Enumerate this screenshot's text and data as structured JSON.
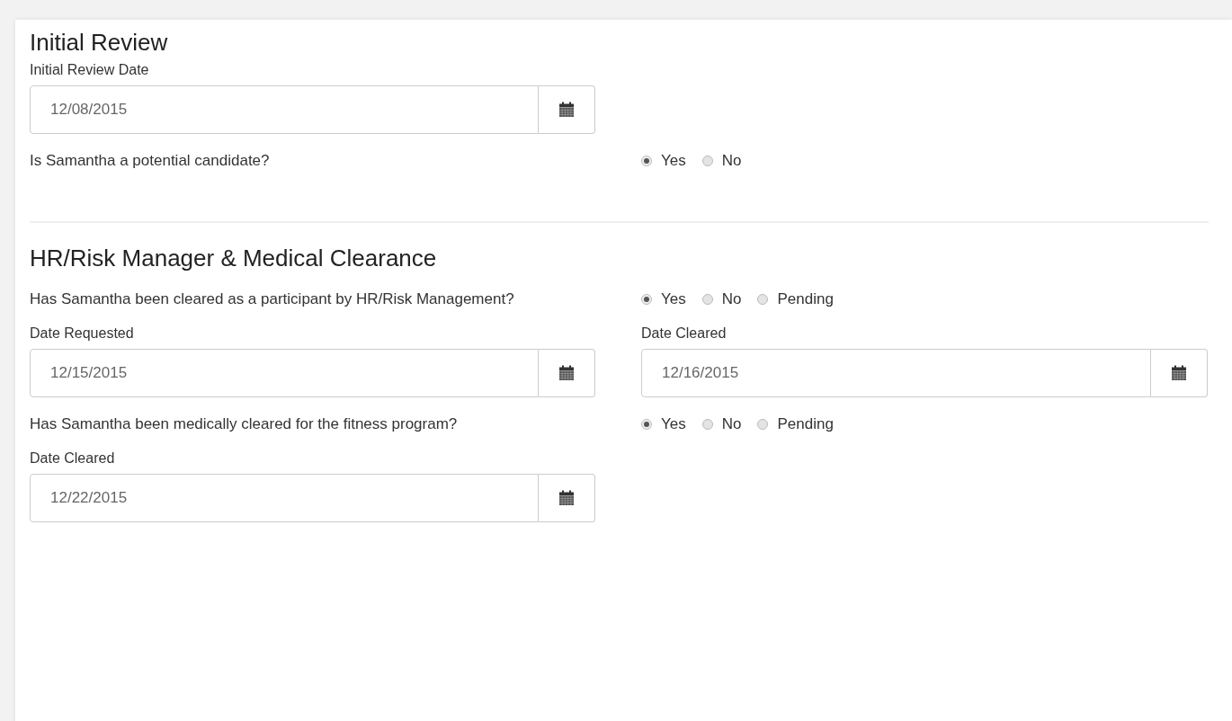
{
  "sections": [
    {
      "title": "Initial Review",
      "rows": [
        {
          "kind": "date",
          "fields": [
            {
              "label": "Initial Review Date",
              "value": "12/08/2015"
            }
          ]
        },
        {
          "kind": "question",
          "text": "Is Samantha a potential candidate?",
          "options": [
            {
              "label": "Yes",
              "selected": true
            },
            {
              "label": "No",
              "selected": false
            }
          ]
        }
      ]
    },
    {
      "title": "HR/Risk Manager & Medical Clearance",
      "rows": [
        {
          "kind": "question",
          "text": "Has Samantha been cleared as a participant by HR/Risk Management?",
          "options": [
            {
              "label": "Yes",
              "selected": true
            },
            {
              "label": "No",
              "selected": false
            },
            {
              "label": "Pending",
              "selected": false
            }
          ]
        },
        {
          "kind": "date",
          "fields": [
            {
              "label": "Date Requested",
              "value": "12/15/2015"
            },
            {
              "label": "Date Cleared",
              "value": "12/16/2015"
            }
          ]
        },
        {
          "kind": "question",
          "text": "Has Samantha been medically cleared for the fitness program?",
          "options": [
            {
              "label": "Yes",
              "selected": true
            },
            {
              "label": "No",
              "selected": false
            },
            {
              "label": "Pending",
              "selected": false
            }
          ]
        },
        {
          "kind": "date",
          "fields": [
            {
              "label": "Date Cleared",
              "value": "12/22/2015"
            }
          ]
        }
      ]
    }
  ]
}
